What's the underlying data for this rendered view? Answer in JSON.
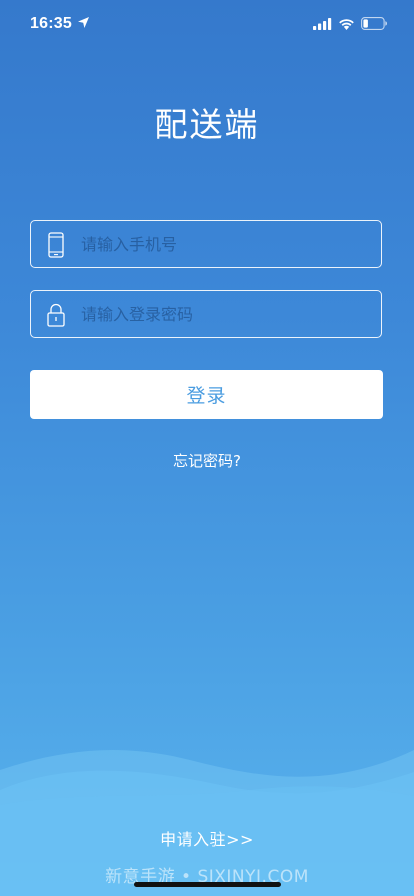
{
  "status_bar": {
    "time": "16:35",
    "icons": [
      "location-arrow-icon",
      "cellular-signal-icon",
      "wifi-icon",
      "battery-icon"
    ]
  },
  "app_title": "配送端",
  "phone_input": {
    "placeholder": "请输入手机号",
    "icon": "phone-icon",
    "value": ""
  },
  "password_input": {
    "placeholder": "请输入登录密码",
    "icon": "lock-icon",
    "value": ""
  },
  "login_button": {
    "label": "登录"
  },
  "forgot_password": "忘记密码?",
  "apply_link": "申请入驻>>",
  "watermark": "新意手游 • SJXINYI.COM",
  "colors": {
    "background_top": "#3579cc",
    "background_bottom": "#5ab4ee",
    "button_text": "#4a9ce0",
    "button_bg": "#ffffff"
  }
}
